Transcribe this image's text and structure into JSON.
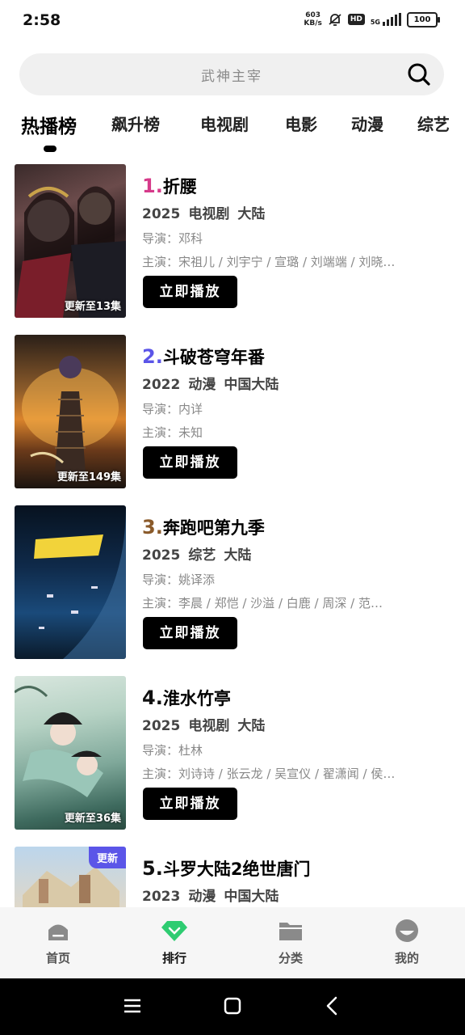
{
  "status_bar": {
    "time": "2:58",
    "net_speed_value": "603",
    "net_speed_unit": "KB/s",
    "hd": "HD",
    "network": "5G",
    "battery": "100"
  },
  "search": {
    "placeholder_text": "武神主宰"
  },
  "tabs": [
    {
      "label": "热播榜",
      "active": true
    },
    {
      "label": "飙升榜",
      "active": false
    },
    {
      "label": "电视剧",
      "active": false
    },
    {
      "label": "电影",
      "active": false
    },
    {
      "label": "动漫",
      "active": false
    },
    {
      "label": "综艺",
      "active": false
    }
  ],
  "rank_colors": [
    "#d63a8a",
    "#5b55e8",
    "#8a5a2a",
    "#111111",
    "#111111"
  ],
  "items": [
    {
      "rank": "1.",
      "title": "折腰",
      "year": "2025",
      "genre": "电视剧",
      "region": "大陆",
      "director": "导演：邓科",
      "cast": "主演：宋祖儿 / 刘宇宁 / 宣璐 / 刘端端 / 刘晓…",
      "poster_update": "更新至13集",
      "play_label": "立即播放"
    },
    {
      "rank": "2.",
      "title": "斗破苍穹年番",
      "year": "2022",
      "genre": "动漫",
      "region": "中国大陆",
      "director": "导演：内详",
      "cast": "主演：未知",
      "poster_update": "更新至149集",
      "play_label": "立即播放"
    },
    {
      "rank": "3.",
      "title": "奔跑吧第九季",
      "year": "2025",
      "genre": "综艺",
      "region": "大陆",
      "director": "导演：姚译添",
      "cast": "主演：李晨 / 郑恺 / 沙溢 / 白鹿 / 周深 / 范…",
      "poster_update": "",
      "play_label": "立即播放"
    },
    {
      "rank": "4.",
      "title": "淮水竹亭",
      "year": "2025",
      "genre": "电视剧",
      "region": "大陆",
      "director": "导演：杜林",
      "cast": "主演：刘诗诗 / 张云龙 / 吴宣仪 / 翟潇闻 / 侯…",
      "poster_update": "更新至36集",
      "play_label": "立即播放"
    },
    {
      "rank": "5.",
      "title": "斗罗大陆2绝世唐门",
      "year": "2023",
      "genre": "动漫",
      "region": "中国大陆",
      "poster_badge": "更新"
    }
  ],
  "bottom_nav": [
    {
      "label": "首页",
      "icon": "home-icon",
      "active": false
    },
    {
      "label": "排行",
      "icon": "diamond-icon",
      "active": true
    },
    {
      "label": "分类",
      "icon": "folder-icon",
      "active": false
    },
    {
      "label": "我的",
      "icon": "profile-icon",
      "active": false
    }
  ],
  "colors": {
    "accent_green": "#2ecc71",
    "play_button": "#000000"
  }
}
